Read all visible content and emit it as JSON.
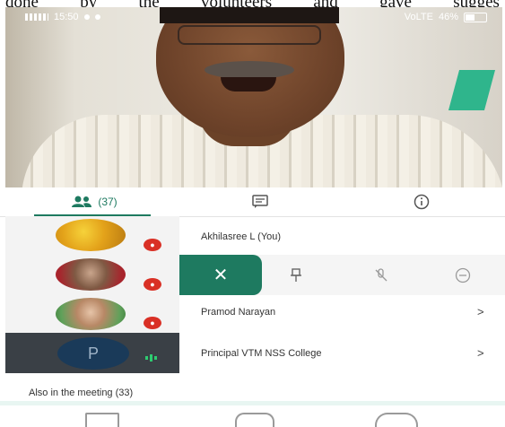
{
  "document_text": [
    "done",
    "by",
    "the",
    "volunteers",
    "and",
    "gave",
    "sugges"
  ],
  "status_bar": {
    "time": "15:50",
    "battery": "46%",
    "signal_left": "4G",
    "network_right": "VoLTE"
  },
  "tabs": {
    "people_count": "(37)",
    "people_icon": "people-icon",
    "chat_icon": "chat-icon",
    "info_icon": "info-icon"
  },
  "participants": [
    {
      "name": "Akhilasree L (You)",
      "muted": true
    },
    {
      "name": "",
      "muted": true,
      "actions_open": true
    },
    {
      "name": "Pramod Narayan",
      "muted": true
    },
    {
      "name": "Principal VTM NSS College",
      "initial": "P",
      "speaking": true
    }
  ],
  "actions": {
    "remove_glyph": "✕",
    "pin_icon": "pin-icon",
    "mute_icon": "mic-off-icon",
    "remove_icon": "minus-circle-icon"
  },
  "chevron": ">",
  "also_in_meeting": "Also in the meeting (33)",
  "colors": {
    "accent": "#1e7a60",
    "muted_badge": "#d93025",
    "speaking": "#2ecc71"
  }
}
